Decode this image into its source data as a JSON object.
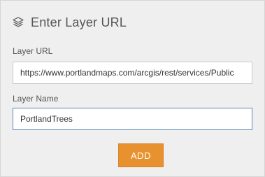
{
  "header": {
    "icon": "layers-icon",
    "title": "Enter Layer URL"
  },
  "form": {
    "url_label": "Layer URL",
    "url_value": "https://www.portlandmaps.com/arcgis/rest/services/Public",
    "name_label": "Layer Name",
    "name_value": "PortlandTrees"
  },
  "actions": {
    "add_label": "ADD"
  },
  "colors": {
    "panel_background": "#efefef",
    "add_button": "#e8922f",
    "focused_border": "#5d86b6"
  }
}
